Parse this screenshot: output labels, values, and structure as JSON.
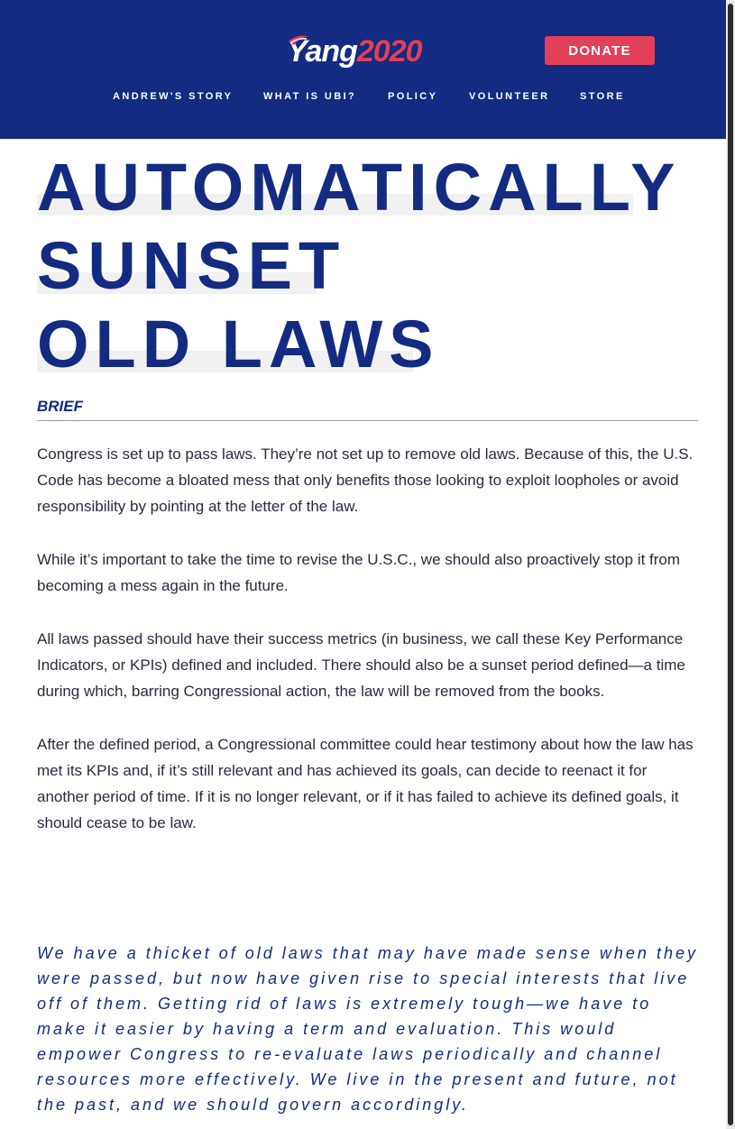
{
  "header": {
    "logo_yang": "Yang",
    "logo_year": "2020",
    "donate_label": "DONATE",
    "nav": [
      "ANDREW'S STORY",
      "WHAT IS UBI?",
      "POLICY",
      "VOLUNTEER",
      "STORE"
    ]
  },
  "title_lines": [
    "AUTOMATICALLY",
    "SUNSET",
    "OLD LAWS"
  ],
  "brief_label": "BRIEF",
  "paragraphs": [
    "Congress is set up to pass laws. They’re not set up to remove old laws. Because of this, the U.S. Code has become a bloated mess that only benefits those looking to exploit loopholes or avoid responsibility by pointing at the letter of the law.",
    "While it’s important to take the time to revise the U.S.C., we should also proactively stop it from becoming a mess again in the future.",
    "All laws passed should have their success metrics (in business, we call these Key Performance Indicators, or KPIs) defined and included. There should also be a sunset period defined—a time during which, barring Congressional action, the law will be removed from the books.",
    "After the defined period, a Congressional committee could hear testimony about how the law has met its KPIs and, if it’s still relevant and has achieved its goals, can decide to reenact it for another period of time. If it is no longer relevant, or if it has failed to achieve its defined goals, it should cease to be law."
  ],
  "quote": "We have a thicket of old laws that may have made sense when they were passed, but now have given rise to special interests that live off of them. Getting rid of laws is extremely tough—we have to make it easier by having a term and evaluation. This would empower Congress to re-evaluate laws periodically and channel resources more effectively. We live in the present and future, not the past, and we should govern accordingly.",
  "colors": {
    "navy": "#132b80",
    "red": "#e23f58"
  }
}
